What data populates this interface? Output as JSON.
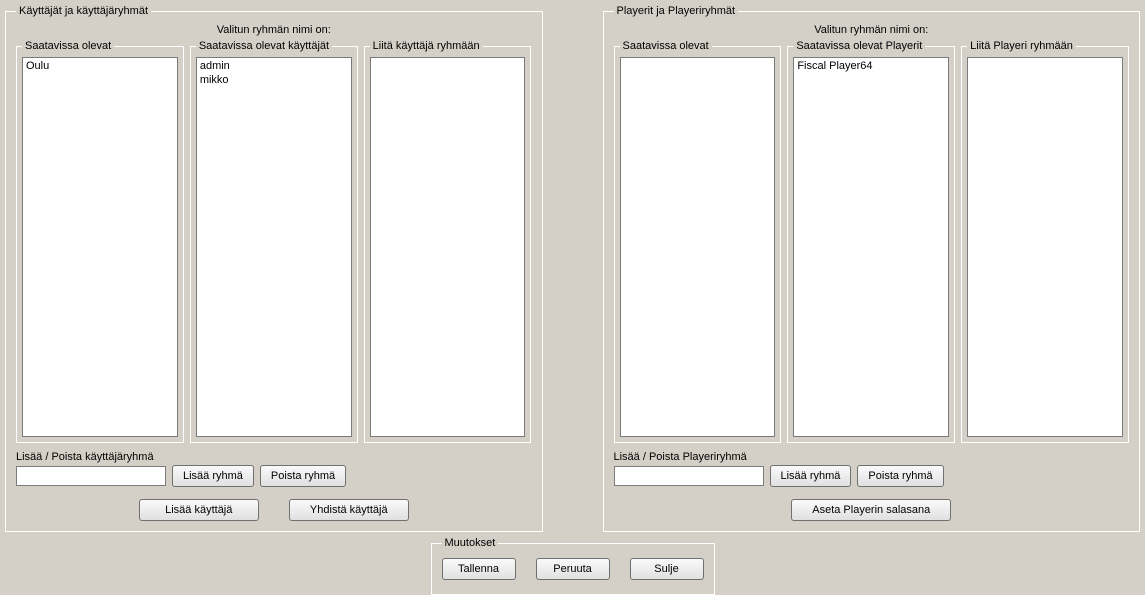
{
  "users_panel": {
    "legend": "Käyttäjät ja käyttäjäryhmät",
    "selected_label": "Valitun ryhmän nimi on:",
    "available_groups_legend": "Saatavissa olevat",
    "available_groups": [
      "Oulu"
    ],
    "available_users_legend": "Saatavissa olevat käyttäjät",
    "available_users": [
      "admin",
      "mikko"
    ],
    "attach_legend": "Liitä käyttäjä ryhmään",
    "attach_items": [],
    "add_remove_label": "Lisää / Poista käyttäjäryhmä",
    "group_input_value": "",
    "add_group_btn": "Lisää ryhmä",
    "remove_group_btn": "Poista ryhmä",
    "add_user_btn": "Lisää käyttäjä",
    "merge_user_btn": "Yhdistä käyttäjä"
  },
  "players_panel": {
    "legend": "Playerit ja Playeriryhmät",
    "selected_label": "Valitun ryhmän nimi on:",
    "available_groups_legend": "Saatavissa olevat",
    "available_groups": [],
    "available_players_legend": "Saatavissa olevat Playerit",
    "available_players": [
      "Fiscal Player64"
    ],
    "attach_legend": "Liitä Playeri ryhmään",
    "attach_items": [],
    "add_remove_label": "Lisää / Poista Playeriryhmä",
    "group_input_value": "",
    "add_group_btn": "Lisää ryhmä",
    "remove_group_btn": "Poista ryhmä",
    "set_password_btn": "Aseta Playerin salasana"
  },
  "changes_panel": {
    "legend": "Muutokset",
    "save_btn": "Tallenna",
    "cancel_btn": "Peruuta",
    "close_btn": "Sulje"
  }
}
